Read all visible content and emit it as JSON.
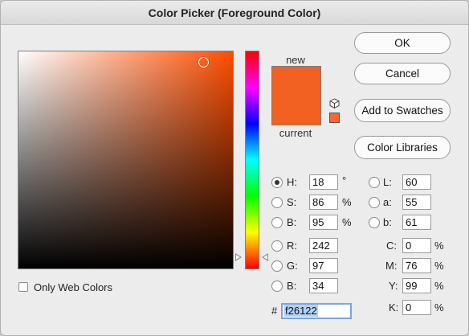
{
  "window": {
    "title": "Color Picker (Foreground Color)"
  },
  "colors": {
    "new": "#f26122",
    "current": "#f26122",
    "websafe": "#ff6633",
    "hue_base": "#ff4d00"
  },
  "preview": {
    "new_label": "new",
    "current_label": "current"
  },
  "buttons": {
    "ok": "OK",
    "cancel": "Cancel",
    "add_to_swatches": "Add to Swatches",
    "color_libraries": "Color Libraries"
  },
  "hsb": {
    "h": {
      "label": "H:",
      "value": "18",
      "unit": "°"
    },
    "s": {
      "label": "S:",
      "value": "86",
      "unit": "%"
    },
    "b": {
      "label": "B:",
      "value": "95",
      "unit": "%"
    }
  },
  "rgb": {
    "r": {
      "label": "R:",
      "value": "242"
    },
    "g": {
      "label": "G:",
      "value": "97"
    },
    "b": {
      "label": "B:",
      "value": "34"
    }
  },
  "lab": {
    "l": {
      "label": "L:",
      "value": "60"
    },
    "a": {
      "label": "a:",
      "value": "55"
    },
    "b": {
      "label": "b:",
      "value": "61"
    }
  },
  "cmyk": {
    "c": {
      "label": "C:",
      "value": "0",
      "unit": "%"
    },
    "m": {
      "label": "M:",
      "value": "76",
      "unit": "%"
    },
    "y": {
      "label": "Y:",
      "value": "99",
      "unit": "%"
    },
    "k": {
      "label": "K:",
      "value": "0",
      "unit": "%"
    }
  },
  "hex": {
    "prefix": "#",
    "value": "f26122"
  },
  "options": {
    "only_web_colors": "Only Web Colors"
  },
  "selected_mode": "H"
}
